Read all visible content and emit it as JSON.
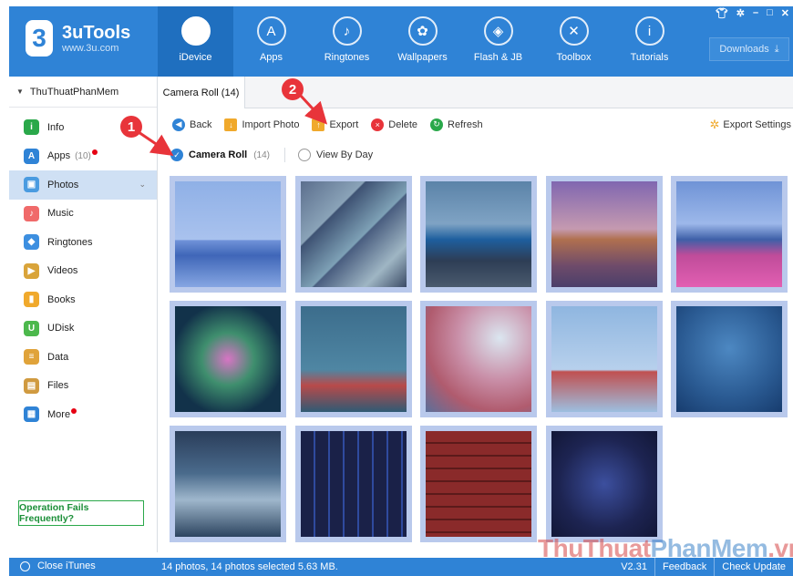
{
  "app": {
    "name": "3uTools",
    "url": "www.3u.com"
  },
  "nav": [
    {
      "label": "iDevice",
      "icon": "apple-icon",
      "glyph": "",
      "active": true
    },
    {
      "label": "Apps",
      "icon": "appstore-icon",
      "glyph": "A"
    },
    {
      "label": "Ringtones",
      "icon": "bell-icon",
      "glyph": "♪"
    },
    {
      "label": "Wallpapers",
      "icon": "flower-icon",
      "glyph": "✿"
    },
    {
      "label": "Flash & JB",
      "icon": "box-icon",
      "glyph": "◈"
    },
    {
      "label": "Toolbox",
      "icon": "tools-icon",
      "glyph": "✕"
    },
    {
      "label": "Tutorials",
      "icon": "info-icon",
      "glyph": "i"
    }
  ],
  "window_controls": [
    "shirt-icon",
    "gear-icon",
    "minimize-icon",
    "maximize-icon",
    "close-icon"
  ],
  "downloads_label": "Downloads",
  "device_name": "ThuThuatPhanMem",
  "sidebar": [
    {
      "label": "Info",
      "icon": "info-icon",
      "color": "#2aa84a",
      "glyph": "i"
    },
    {
      "label": "Apps",
      "count": "(10)",
      "dot": true,
      "icon": "apps-icon",
      "color": "#2f83d6",
      "glyph": "A"
    },
    {
      "label": "Photos",
      "icon": "photos-icon",
      "color": "#4a9be0",
      "glyph": "▣",
      "active": true
    },
    {
      "label": "Music",
      "icon": "music-icon",
      "color": "#f06a6a",
      "glyph": "♪"
    },
    {
      "label": "Ringtones",
      "icon": "bell-icon",
      "color": "#3d8fe0",
      "glyph": "◆"
    },
    {
      "label": "Videos",
      "icon": "videos-icon",
      "color": "#d9a43a",
      "glyph": "▶"
    },
    {
      "label": "Books",
      "icon": "books-icon",
      "color": "#f0a92c",
      "glyph": "▮"
    },
    {
      "label": "UDisk",
      "icon": "udisk-icon",
      "color": "#4cb84c",
      "glyph": "U"
    },
    {
      "label": "Data",
      "icon": "data-icon",
      "color": "#e0a33a",
      "glyph": "≡"
    },
    {
      "label": "Files",
      "icon": "files-icon",
      "color": "#d09a40",
      "glyph": "▤"
    },
    {
      "label": "More",
      "dot": true,
      "icon": "more-icon",
      "color": "#2f83d6",
      "glyph": "▦"
    }
  ],
  "op_fails": "Operation Fails Frequently?",
  "tab": "Camera Roll (14)",
  "toolbar": [
    {
      "label": "Back",
      "icon": "back-icon",
      "color": "#2f83d6",
      "glyph": "◀"
    },
    {
      "label": "Import Photo",
      "icon": "import-icon",
      "color": "#f0a92c",
      "glyph": "↓"
    },
    {
      "label": "Export",
      "icon": "export-icon",
      "color": "#f0a92c",
      "glyph": "↑"
    },
    {
      "label": "Delete",
      "icon": "delete-icon",
      "color": "#e8343a",
      "glyph": "×"
    },
    {
      "label": "Refresh",
      "icon": "refresh-icon",
      "color": "#2aa84a",
      "glyph": "↻"
    }
  ],
  "export_settings": "Export Settings",
  "view": {
    "camera_roll": "Camera Roll",
    "camera_roll_count": "(14)",
    "by_day": "View By Day"
  },
  "photos": [
    {
      "name": "mountain-lake",
      "bg": "linear-gradient(180deg,#8fb0e6 0%,#a9c2ee 55%,#6f92d8 56%,#3f66b8 70%,#86a6e2 100%)"
    },
    {
      "name": "abstract-stripes",
      "bg": "linear-gradient(135deg,#5b6e8d 0%,#8aa3b8 30%,#3e5273 31%,#7ea1b6 55%,#4a5e80 56%,#9fb6c4 80%,#3b4b66 100%)"
    },
    {
      "name": "blue-car",
      "bg": "linear-gradient(180deg,#5b83a8 0%,#7fa3c4 40%,#1e5f9e 55%,#2d3d55 75%,#4a5b6e 100%)"
    },
    {
      "name": "desert-rock",
      "bg": "linear-gradient(180deg,#8066b0 0%,#c59ab0 45%,#b0704f 55%,#6e4b6a 80%,#4b3f6a 100%)"
    },
    {
      "name": "mountain-flowers",
      "bg": "linear-gradient(180deg,#6f93d6 0%,#9db8ea 40%,#3e60a8 55%,#c04c9a 70%,#e25fb2 100%)"
    },
    {
      "name": "flowers-dark",
      "bg": "radial-gradient(circle at 50% 50%,#d775c4 0%,#3f8f6e 35%,#12324a 75%)"
    },
    {
      "name": "red-house",
      "bg": "linear-gradient(180deg,#3c6d8c 0%,#4f86a3 60%,#b84a4a 75%,#2f5a74 100%)"
    },
    {
      "name": "pink-tree",
      "bg": "radial-gradient(circle at 70% 30%,#dbe6f0 0%,#c98fa8 40%,#b05b6e 70%,#5b6f9a 100%)"
    },
    {
      "name": "golden-gate",
      "bg": "linear-gradient(180deg,#8fb6e0 0%,#b7d0ec 60%,#c05050 62%,#9dbfe0 100%)"
    },
    {
      "name": "blue-ocean",
      "bg": "radial-gradient(circle at 50% 40%,#4d88c2 0%,#2a5a92 60%,#173c6e 100%)"
    },
    {
      "name": "city-wave",
      "bg": "linear-gradient(180deg,#2a3d5a 0%,#4a6b8c 40%,#9fb7cc 65%,#2d4560 100%)"
    },
    {
      "name": "pacman-game",
      "bg": "repeating-linear-gradient(90deg,#1a2148 0 14px,#2f4a9e 14px 16px)"
    },
    {
      "name": "brick-wall",
      "bg": "repeating-linear-gradient(180deg,#8a2a2a 0 12px,#5b1a1a 12px 14px)"
    },
    {
      "name": "apps-circle",
      "bg": "radial-gradient(circle at 50% 50%,#3c4f9e 0%,#1d2452 60%,#121737 100%)"
    }
  ],
  "markers": [
    "1",
    "2"
  ],
  "status": {
    "close_itunes": "Close iTunes",
    "info": "14 photos, 14 photos selected 5.63 MB.",
    "version": "V2.31",
    "feedback": "Feedback",
    "check_update": "Check Update"
  },
  "watermark": {
    "part1": "ThuThuat",
    "part2": "PhanMem",
    "part3": ".vn"
  }
}
